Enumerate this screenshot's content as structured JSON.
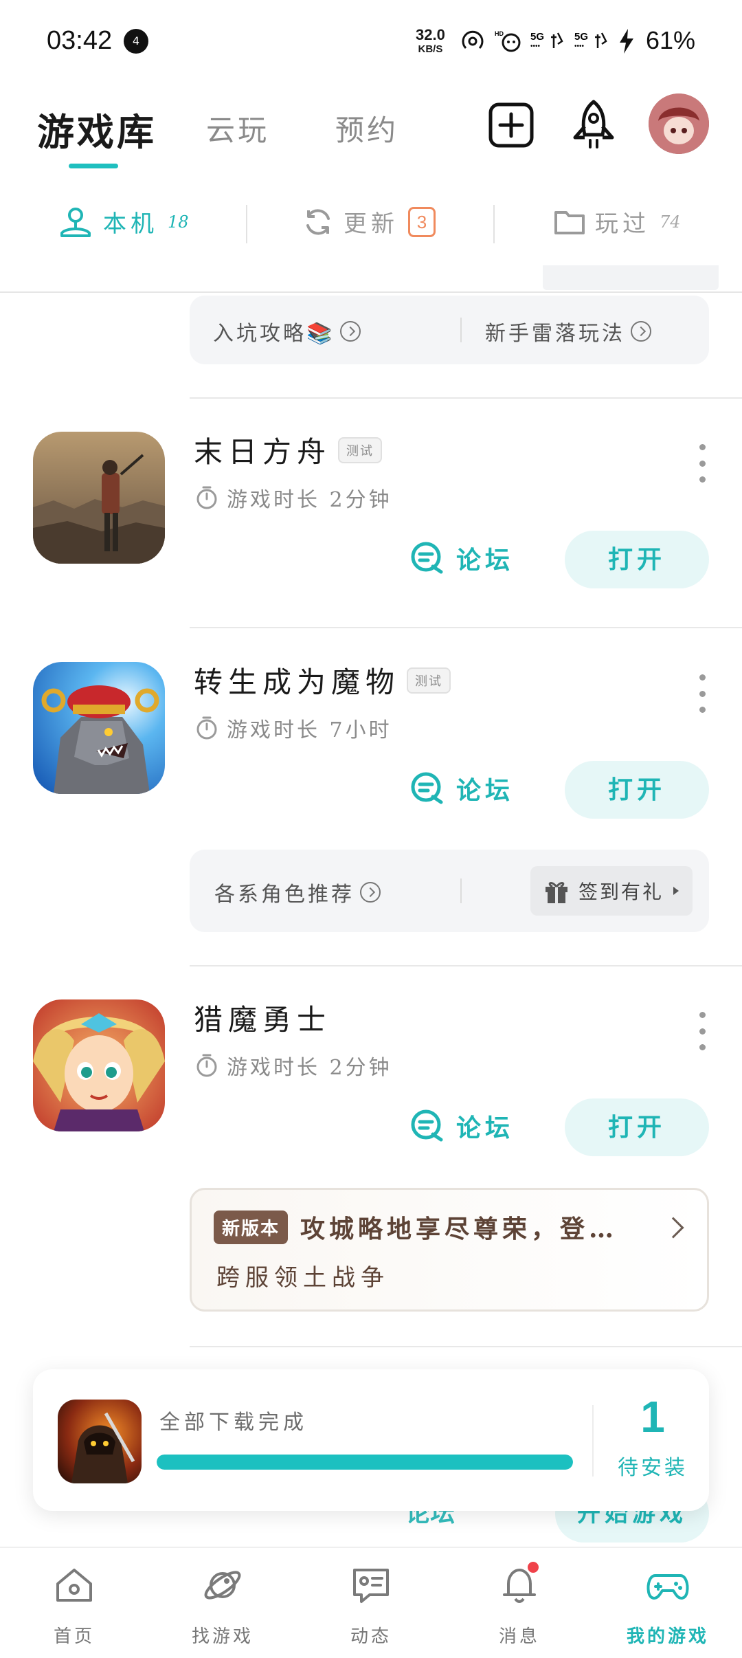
{
  "status_bar": {
    "time": "03:42",
    "notif_count": "4",
    "net_speed_value": "32.0",
    "net_speed_unit": "KB/S",
    "signal_5g_1": "5G",
    "signal_5g_2": "5G",
    "battery": "61%"
  },
  "header": {
    "tabs": [
      {
        "label": "游戏库",
        "active": true
      },
      {
        "label": "云玩",
        "active": false
      },
      {
        "label": "预约",
        "active": false
      }
    ],
    "icons": [
      "add-icon",
      "rocket-icon",
      "avatar"
    ]
  },
  "subtabs": [
    {
      "label": "本机",
      "count": "18",
      "icon": "local-device-icon",
      "active": true
    },
    {
      "label": "更新",
      "count": "3",
      "icon": "refresh-icon",
      "active": false
    },
    {
      "label": "玩过",
      "count": "74",
      "icon": "folder-icon",
      "active": false
    }
  ],
  "top_tips": {
    "left": "入坑攻略📚",
    "right": "新手雷落玩法"
  },
  "games": [
    {
      "title": "末日方舟",
      "tag": "测试",
      "playtime": "游戏时长 2分钟",
      "forum_label": "论坛",
      "open_label": "打开"
    },
    {
      "title": "转生成为魔物",
      "tag": "测试",
      "playtime": "游戏时长 7小时",
      "forum_label": "论坛",
      "open_label": "打开",
      "tips_left": "各系角色推荐",
      "gift_label": "签到有礼"
    },
    {
      "title": "猎魔勇士",
      "tag": "",
      "playtime": "游戏时长 2分钟",
      "forum_label": "论坛",
      "open_label": "打开",
      "news_tag": "新版本",
      "news_title": "攻城略地享尽尊荣，登…",
      "news_sub": "跨服领土战争"
    }
  ],
  "ghost_row": {
    "forum_label": "论坛",
    "open_label": "开始游戏"
  },
  "download": {
    "label": "全部下载完成",
    "progress": 1.0,
    "count": "1",
    "count_label": "待安装"
  },
  "bottom_nav": [
    {
      "label": "首页",
      "icon": "home-icon",
      "active": false
    },
    {
      "label": "找游戏",
      "icon": "planet-icon",
      "active": false
    },
    {
      "label": "动态",
      "icon": "chat-card-icon",
      "active": false
    },
    {
      "label": "消息",
      "icon": "bell-icon",
      "active": false,
      "dot": true
    },
    {
      "label": "我的游戏",
      "icon": "gamepad-icon",
      "active": true
    }
  ],
  "colors": {
    "accent": "#1fb5b5",
    "update_badge": "#f08a5d",
    "news_tag_bg": "#7b5a4a",
    "notification_dot": "#f0424a"
  }
}
